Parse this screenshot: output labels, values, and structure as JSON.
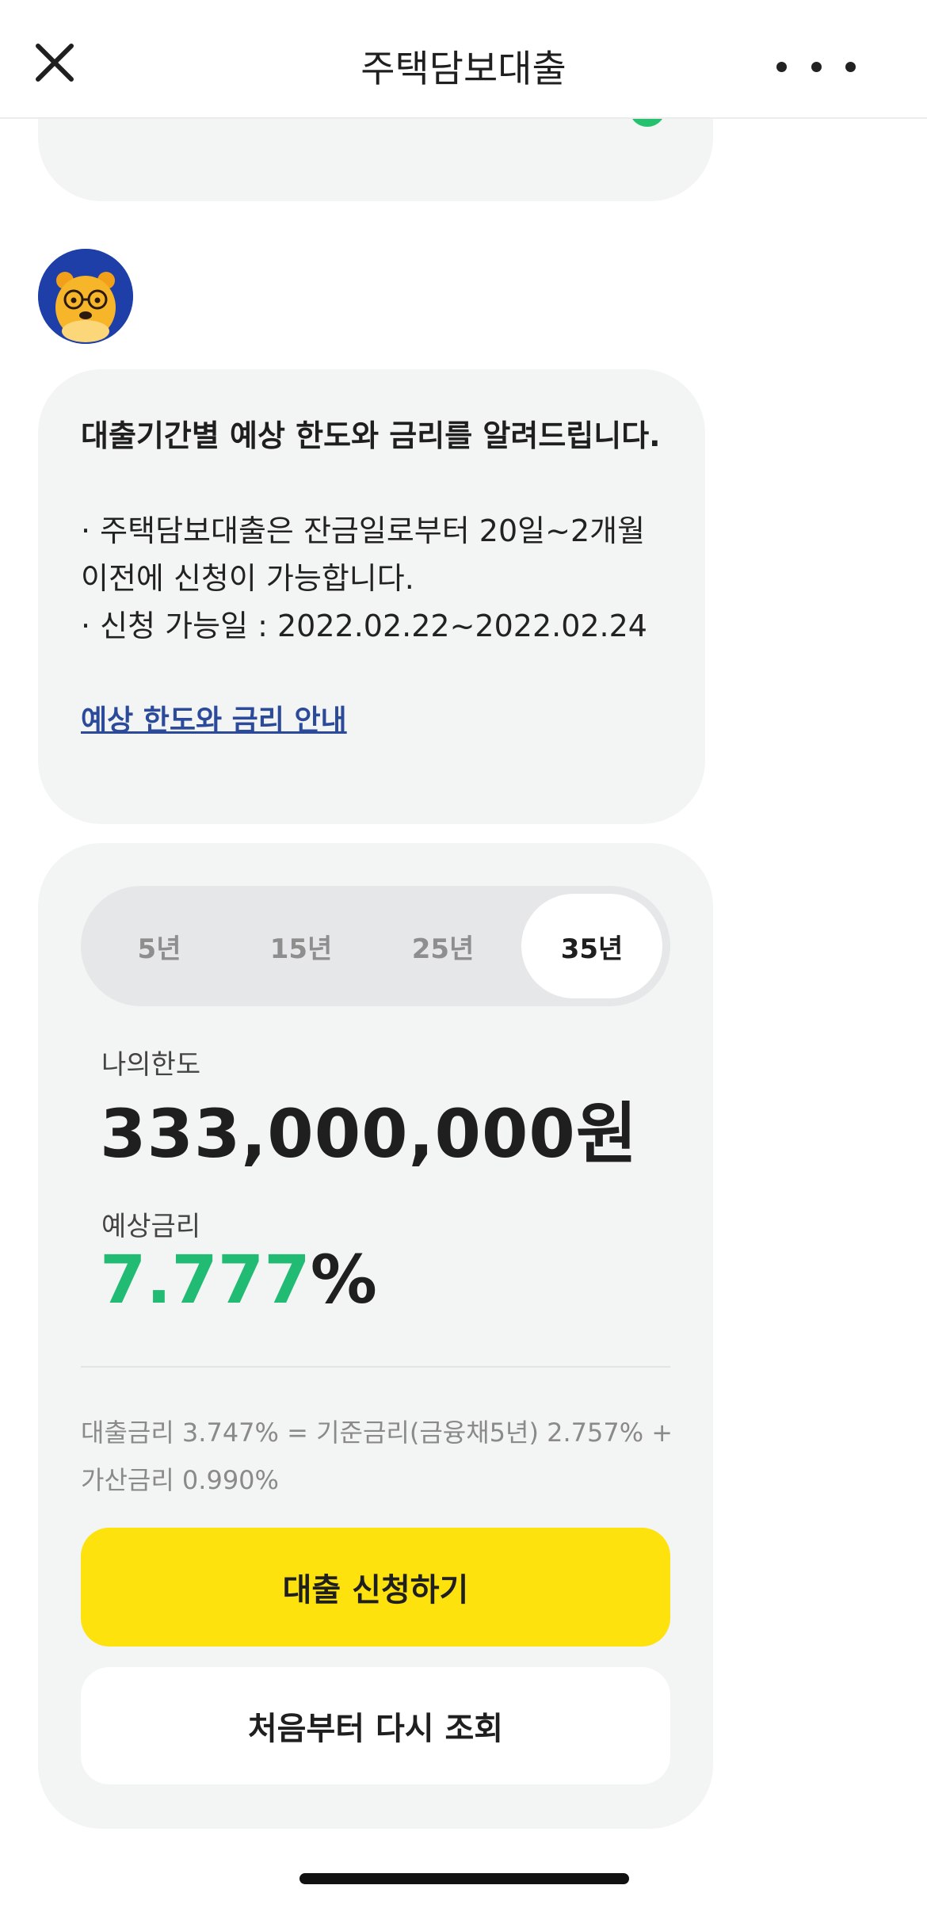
{
  "header": {
    "title": "주택담보대출",
    "close_icon": "close-icon",
    "more_icon": "more-horizontal-icon"
  },
  "colors": {
    "accent_green": "#22bb74",
    "primary_button": "#fde20d",
    "bubble_bg": "#f3f4f4",
    "link": "#2b4a9a"
  },
  "avatar": {
    "icon": "bear-character-avatar"
  },
  "message": {
    "title": "대출기간별 예상 한도와 금리를 알려드립니다.",
    "bullet1": "· 주택담보대출은 잔금일로부터 20일~2개월 이전에 신청이 가능합니다.",
    "bullet2": "· 신청 가능일 : 2022.02.22~2022.02.24",
    "link": "예상 한도와 금리 안내"
  },
  "period_tabs": [
    {
      "label": "5년",
      "selected": false
    },
    {
      "label": "15년",
      "selected": false
    },
    {
      "label": "25년",
      "selected": false
    },
    {
      "label": "35년",
      "selected": true
    }
  ],
  "result": {
    "limit_label": "나의한도",
    "limit_value": "333,000,000원",
    "rate_label": "예상금리",
    "rate_number": "7.777",
    "rate_unit": "%",
    "note": "대출금리 3.747% = 기준금리(금융채5년) 2.757% + 가산금리 0.990%"
  },
  "buttons": {
    "apply": "대출 신청하기",
    "restart": "처음부터 다시 조회"
  }
}
